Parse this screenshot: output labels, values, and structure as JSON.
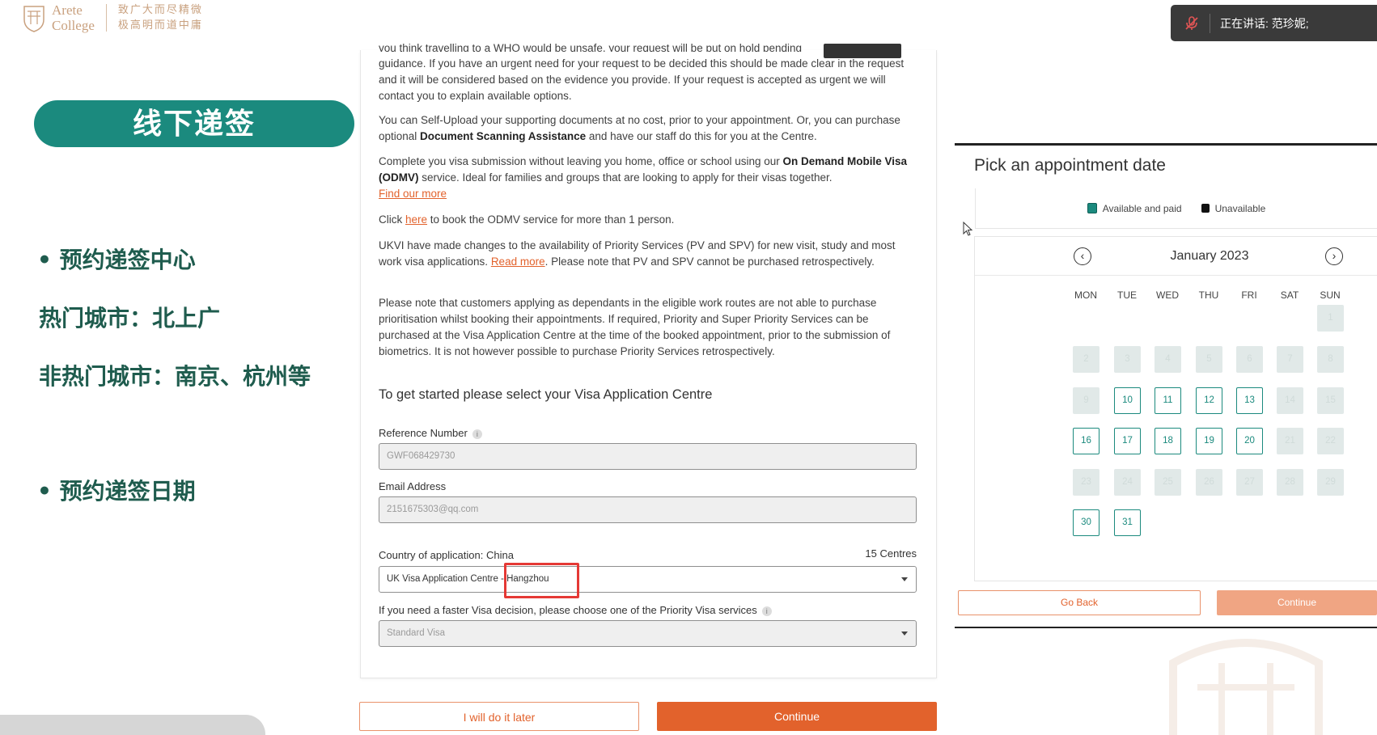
{
  "logo": {
    "name_line1": "Arete",
    "name_line2": "College",
    "motto_line1": "致广大而尽精微",
    "motto_line2": "极高明而道中庸"
  },
  "speaking": {
    "label": "正在讲话: 范珍妮;"
  },
  "slide": {
    "pill_title": "线下递签",
    "bullet1": "• 预约递签中心",
    "hot_cities": "热门城市：北上广",
    "other_cities": "非热门城市：南京、杭州等",
    "bullet2": "• 预约递签日期"
  },
  "form": {
    "cut_line": "you think travelling to a WHO would be unsafe, your request will be put on hold pending guidance from the FCDO",
    "p1": "guidance. If you have an urgent need for your request to be decided this should be made clear in the request and it will be considered based on the evidence you provide. If your request is accepted as urgent we will contact you to explain available options.",
    "p2_pre": "You can Self-Upload your supporting documents at no cost, prior to your appointment. Or, you can purchase optional ",
    "p2_bold": "Document Scanning Assistance",
    "p2_post": " and have our staff do this for you at the Centre.",
    "p3_pre": "Complete you visa submission without leaving you home, office or school using our ",
    "p3_bold": "On Demand Mobile Visa (ODMV)",
    "p3_post": " service. Ideal for families and groups that are looking to apply for their visas together.",
    "p3_link": "Find our more",
    "p4_pre": "Click ",
    "p4_link": "here",
    "p4_post": " to book the ODMV service for more than 1 person.",
    "p5_pre": "UKVI have made changes to the availability of Priority Services (PV and SPV) for new visit, study and most work visa applications. ",
    "p5_link": "Read more",
    "p5_post": ". Please note that PV and SPV cannot be purchased retrospectively.",
    "p6": "Please note that customers applying as dependants in the eligible work routes are not able to purchase prioritisation whilst booking their appointments. If required, Priority and Super Priority Services can be purchased at the Visa Application Centre at the time of the booked appointment, prior to the submission of biometrics. It is not however possible to purchase Priority Services retrospectively.",
    "heading": "To get started please select your Visa Application Centre",
    "ref_label": "Reference Number",
    "ref_value": "GWF068429730",
    "email_label": "Email Address",
    "email_value": "2151675303@qq.com",
    "country_label": "Country of application: China",
    "centres_count": "15 Centres",
    "centre_value": "UK Visa Application Centre - Hangzhou",
    "priority_label": "If you need a faster Visa decision, please choose one of the Priority Visa services",
    "priority_value": "Standard Visa",
    "later_button": "I will do it later",
    "continue_button": "Continue"
  },
  "calendar": {
    "title": "Pick an appointment date",
    "legend_available": "Available and paid",
    "legend_unavailable": "Unavailable",
    "month": "January 2023",
    "weekdays": [
      "MON",
      "TUE",
      "WED",
      "THU",
      "FRI",
      "SAT",
      "SUN"
    ],
    "days": [
      {
        "d": "1",
        "available": false
      },
      {
        "d": "2",
        "available": false
      },
      {
        "d": "3",
        "available": false
      },
      {
        "d": "4",
        "available": false
      },
      {
        "d": "5",
        "available": false
      },
      {
        "d": "6",
        "available": false
      },
      {
        "d": "7",
        "available": false
      },
      {
        "d": "8",
        "available": false
      },
      {
        "d": "9",
        "available": false
      },
      {
        "d": "10",
        "available": true
      },
      {
        "d": "11",
        "available": true
      },
      {
        "d": "12",
        "available": true
      },
      {
        "d": "13",
        "available": true
      },
      {
        "d": "14",
        "available": false
      },
      {
        "d": "15",
        "available": false
      },
      {
        "d": "16",
        "available": true
      },
      {
        "d": "17",
        "available": true
      },
      {
        "d": "18",
        "available": true
      },
      {
        "d": "19",
        "available": true
      },
      {
        "d": "20",
        "available": true
      },
      {
        "d": "21",
        "available": false
      },
      {
        "d": "22",
        "available": false
      },
      {
        "d": "23",
        "available": false
      },
      {
        "d": "24",
        "available": false
      },
      {
        "d": "25",
        "available": false
      },
      {
        "d": "26",
        "available": false
      },
      {
        "d": "27",
        "available": false
      },
      {
        "d": "28",
        "available": false
      },
      {
        "d": "29",
        "available": false
      },
      {
        "d": "30",
        "available": true
      },
      {
        "d": "31",
        "available": true
      }
    ],
    "go_back": "Go Back",
    "continue": "Continue"
  },
  "colors": {
    "accent_teal": "#1b8a7e",
    "accent_orange": "#e2622c",
    "highlight_red": "#e53935",
    "logo_gold": "#c9a17f"
  }
}
